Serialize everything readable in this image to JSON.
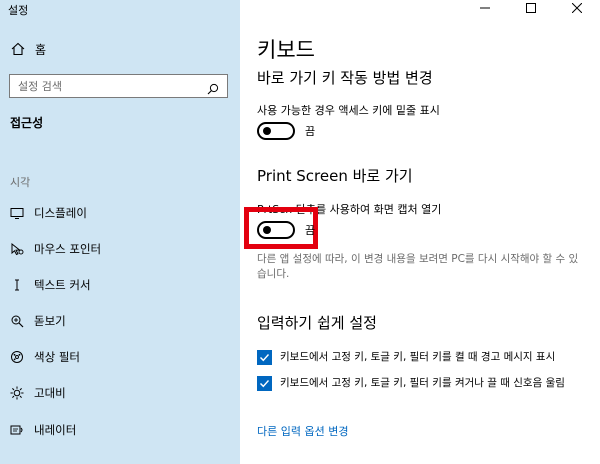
{
  "window": {
    "title": "설정"
  },
  "sidebar": {
    "home_label": "홈",
    "search_placeholder": "설정 검색",
    "category": "접근성",
    "section_label": "시각",
    "items": [
      {
        "label": "디스플레이",
        "icon": "monitor-icon"
      },
      {
        "label": "마우스 포인터",
        "icon": "mouse-pointer-icon"
      },
      {
        "label": "텍스트 커서",
        "icon": "text-cursor-icon"
      },
      {
        "label": "돋보기",
        "icon": "magnifier-icon"
      },
      {
        "label": "색상 필터",
        "icon": "color-filter-icon"
      },
      {
        "label": "고대비",
        "icon": "high-contrast-icon"
      },
      {
        "label": "내레이터",
        "icon": "narrator-icon"
      }
    ]
  },
  "main": {
    "title": "키보드",
    "shortcut_section": {
      "heading": "바로 가기 키 작동 방법 변경",
      "underline_label": "사용 가능한 경우 액세스 키에 밑줄 표시",
      "underline_state": "끔"
    },
    "printscreen_section": {
      "heading": "Print Screen 바로 가기",
      "setting_label": "PrtScn 단추를 사용하여 화면 캡처 열기",
      "setting_state": "끔",
      "note": "다른 앱 설정에 따라, 이 변경 내용을 보려면 PC를 다시 시작해야 할 수 있습니다."
    },
    "typing_section": {
      "heading": "입력하기 쉽게 설정",
      "checkbox1": "키보드에서 고정 키, 토글 키, 필터 키를 켤 때 경고 메시지 표시",
      "checkbox2": "키보드에서 고정 키, 토글 키, 필터 키를 켜거나 끌 때 신호음 울림"
    },
    "link": "다른 입력 옵션 변경"
  },
  "colors": {
    "sidebar_bg": "#cfe5f3",
    "accent": "#0067c0",
    "highlight": "#e3000f"
  }
}
